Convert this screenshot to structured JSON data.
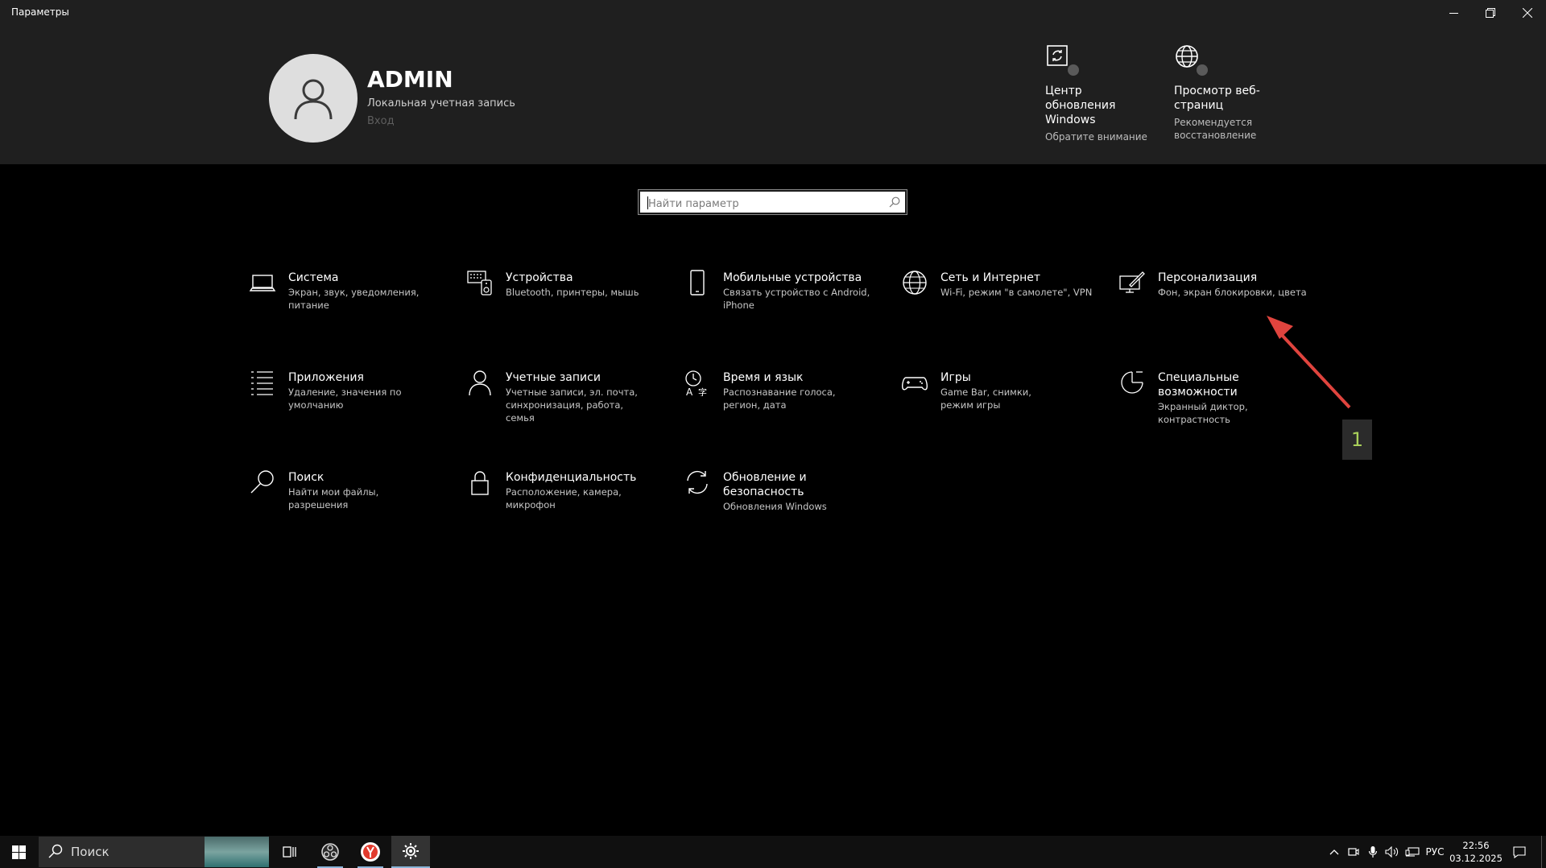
{
  "window": {
    "title": "Параметры"
  },
  "user": {
    "name": "ADMIN",
    "account_type": "Локальная учетная запись",
    "login_link": "Вход"
  },
  "header_cards": [
    {
      "name": "update",
      "label": "Центр обновления Windows",
      "sub": "Обратите внимание",
      "icon": "sync-icon"
    },
    {
      "name": "browser",
      "label": "Просмотр веб-страниц",
      "sub": "Рекомендуется восстановление",
      "icon": "globe-icon"
    }
  ],
  "search": {
    "placeholder": "Найти параметр"
  },
  "tiles": [
    {
      "title": "Система",
      "desc": "Экран, звук, уведомления, питание",
      "icon": "laptop-icon"
    },
    {
      "title": "Устройства",
      "desc": "Bluetooth, принтеры, мышь",
      "icon": "keyboard-icon"
    },
    {
      "title": "Мобильные устройства",
      "desc": "Связать устройство с Android, iPhone",
      "icon": "phone-icon"
    },
    {
      "title": "Сеть и Интернет",
      "desc": "Wi-Fi, режим \"в самолете\", VPN",
      "icon": "globe-icon"
    },
    {
      "title": "Персонализация",
      "desc": "Фон, экран блокировки, цвета",
      "icon": "paint-icon"
    },
    {
      "title": "Приложения",
      "desc": "Удаление, значения по умолчанию",
      "icon": "apps-list-icon"
    },
    {
      "title": "Учетные записи",
      "desc": "Учетные записи, эл. почта, синхронизация, работа, семья",
      "icon": "person-icon"
    },
    {
      "title": "Время и язык",
      "desc": "Распознавание голоса, регион, дата",
      "icon": "time-language-icon"
    },
    {
      "title": "Игры",
      "desc": "Game Bar, снимки, режим игры",
      "icon": "gamepad-icon"
    },
    {
      "title": "Специальные возможности",
      "desc": "Экранный диктор, контрастность",
      "icon": "accessibility-icon"
    },
    {
      "title": "Поиск",
      "desc": "Найти мои файлы, разрешения",
      "icon": "search-icon"
    },
    {
      "title": "Конфиденциальность",
      "desc": "Расположение, камера, микрофон",
      "icon": "lock-icon"
    },
    {
      "title": "Обновление и безопасность",
      "desc": "Обновления Windows",
      "icon": "sync-icon"
    }
  ],
  "annotation": {
    "number": "1",
    "arrow_color": "#e0443e"
  },
  "taskbar": {
    "search_label": "Поиск",
    "language": "РУС",
    "time": "22:56",
    "date": "03.12.2025"
  }
}
